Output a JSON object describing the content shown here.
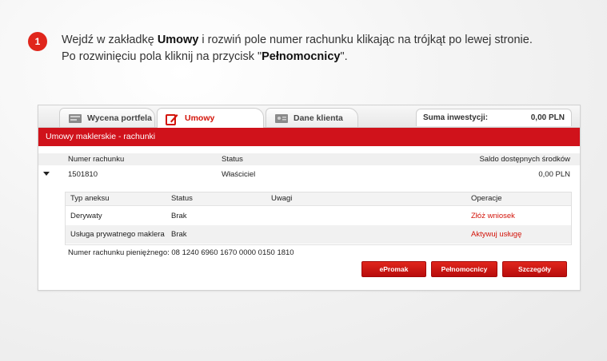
{
  "step": {
    "number": "1",
    "line1_prefix": "Wejdź w zakładkę ",
    "line1_bold": "Umowy",
    "line1_suffix": " i rozwiń pole numer rachunku klikając na trójkąt po lewej stronie.",
    "line2_prefix": "Po rozwinięciu pola kliknij na przycisk \"",
    "line2_bold": "Pełnomocnicy",
    "line2_suffix": "\"."
  },
  "tabs": [
    {
      "label": "Wycena portfela",
      "icon": "portfolio-icon",
      "active": false
    },
    {
      "label": "Umowy",
      "icon": "pen-icon",
      "active": true
    },
    {
      "label": "Dane klienta",
      "icon": "client-card-icon",
      "active": false
    }
  ],
  "summary": {
    "label": "Suma inwestycji:",
    "value": "0,00 PLN"
  },
  "section_title": "Umowy maklerskie - rachunki",
  "accounts_table": {
    "headers": [
      "Numer rachunku",
      "Status",
      "Saldo dostępnych środków"
    ],
    "row": {
      "number": "1501810",
      "status": "Właściciel",
      "balance": "0,00 PLN"
    }
  },
  "annex_table": {
    "headers": [
      "Typ aneksu",
      "Status",
      "Uwagi",
      "Operacje"
    ],
    "rows": [
      {
        "type": "Derywaty",
        "status": "Brak",
        "notes": "",
        "operation": "Złóż wniosek"
      },
      {
        "type": "Usługa prywatnego maklera",
        "status": "Brak",
        "notes": "",
        "operation": "Aktywuj usługę"
      }
    ]
  },
  "cash_account": "Numer rachunku pieniężnego: 08 1240 6960 1670 0000 0150 1810",
  "buttons": [
    "ePromak",
    "Pełnomocnicy",
    "Szczegóły"
  ],
  "colors": {
    "accent": "#d0121b",
    "badge": "#e0261c"
  }
}
